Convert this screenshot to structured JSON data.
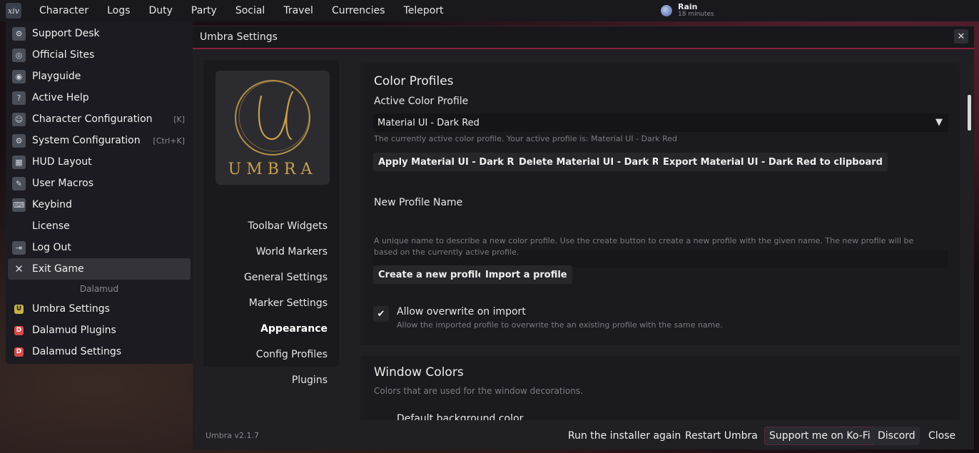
{
  "toolbar": {
    "logo": "xiv",
    "items": [
      "Character",
      "Logs",
      "Duty",
      "Party",
      "Social",
      "Travel",
      "Currencies",
      "Teleport"
    ],
    "weather": {
      "name": "Rain",
      "time": "18 minutes"
    }
  },
  "main_menu": {
    "items": [
      {
        "label": "Support Desk",
        "icon": "support-icon",
        "shortcut": ""
      },
      {
        "label": "Official Sites",
        "icon": "globe-icon",
        "shortcut": ""
      },
      {
        "label": "Playguide",
        "icon": "book-icon",
        "shortcut": ""
      },
      {
        "label": "Active Help",
        "icon": "help-icon",
        "shortcut": ""
      },
      {
        "label": "Character Configuration",
        "icon": "character-config-icon",
        "shortcut": "[K]"
      },
      {
        "label": "System Configuration",
        "icon": "system-config-icon",
        "shortcut": "[Ctrl+K]"
      },
      {
        "label": "HUD Layout",
        "icon": "hud-icon",
        "shortcut": ""
      },
      {
        "label": "User Macros",
        "icon": "macro-icon",
        "shortcut": ""
      },
      {
        "label": "Keybind",
        "icon": "keybind-icon",
        "shortcut": ""
      },
      {
        "label": "License",
        "icon": "",
        "shortcut": ""
      },
      {
        "label": "Log Out",
        "icon": "logout-icon",
        "shortcut": ""
      },
      {
        "label": "Exit Game",
        "icon": "close-icon",
        "shortcut": ""
      }
    ],
    "section_label": "Dalamud",
    "dalamud_items": [
      {
        "label": "Umbra Settings",
        "badge": "U"
      },
      {
        "label": "Dalamud Plugins",
        "badge": "D"
      },
      {
        "label": "Dalamud Settings",
        "badge": "D"
      }
    ]
  },
  "window": {
    "title": "Umbra Settings",
    "close_glyph": "✕",
    "logo_word": "UMBRA",
    "nav": [
      "Toolbar Widgets",
      "World Markers",
      "General Settings",
      "Marker Settings",
      "Appearance",
      "Config Profiles",
      "Plugins"
    ],
    "color_profiles": {
      "heading": "Color Profiles",
      "active_label": "Active Color Profile",
      "active_value": "Material UI - Dark Red",
      "active_hint": "The currently active color profile. Your active profile is: Material UI - Dark Red",
      "apply_button": "Apply Material UI - Dark Red",
      "delete_button": "Delete Material UI - Dark Red",
      "export_button": "Export Material UI - Dark Red to clipboard",
      "new_name_label": "New Profile Name",
      "new_name_value": "",
      "new_name_hint": "A unique name to describe a new color profile. Use the create button to create a new profile with the given name. The new profile will be based on the currently active profile.",
      "create_button": "Create a new profile",
      "import_button": "Import a profile",
      "overwrite_label": "Allow overwrite on import",
      "overwrite_checked": true,
      "overwrite_hint": "Allow the imported profile to overwrite the an existing profile with the same name."
    },
    "window_colors": {
      "heading": "Window Colors",
      "hint": "Colors that are used for the window decorations.",
      "partial_item": "Default background color"
    },
    "footer": {
      "version": "Umbra v2.1.7",
      "buttons": [
        "Run the installer again",
        "Restart Umbra",
        "Support me on Ko-Fi",
        "Discord",
        "Close"
      ]
    }
  }
}
